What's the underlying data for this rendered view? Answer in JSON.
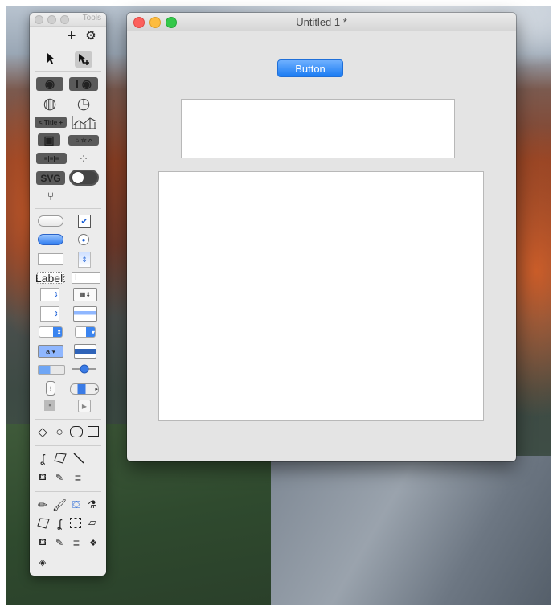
{
  "tools_palette": {
    "title": "Tools",
    "label_tool": "Label:",
    "title_bar_widget": "< Title +",
    "svg_widget": "SVG"
  },
  "window": {
    "title": "Untitled 1 *",
    "button_label": "Button"
  },
  "colors": {
    "accent": "#1a7bf2",
    "close": "#fc605c",
    "minimize": "#fdbc40",
    "zoom": "#34c84a"
  }
}
